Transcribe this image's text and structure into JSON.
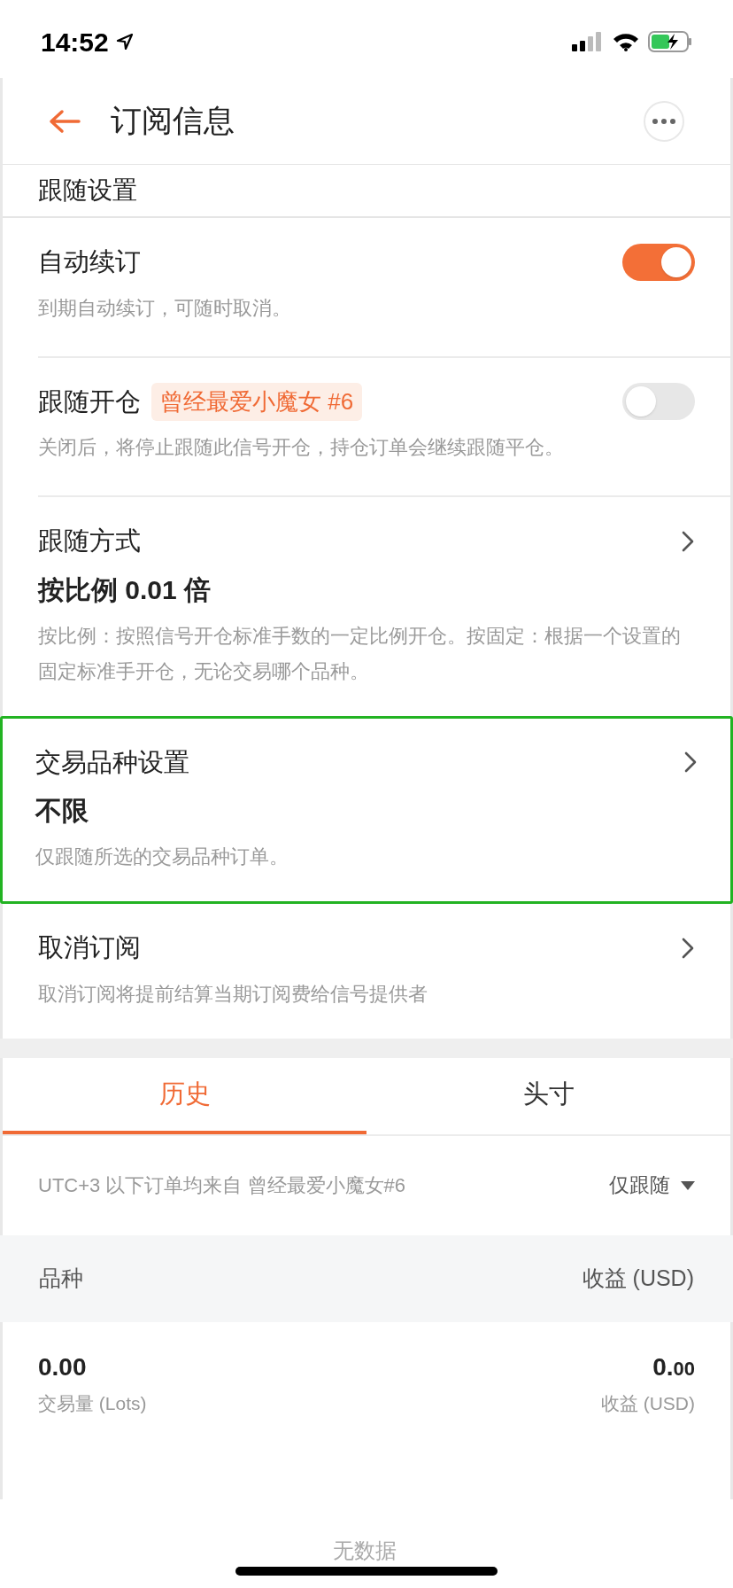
{
  "status_bar": {
    "time": "14:52"
  },
  "header": {
    "title": "订阅信息"
  },
  "section_title": "跟随设置",
  "settings": [
    {
      "kind": "toggle",
      "title": "自动续订",
      "on": true,
      "description": "到期自动续订，可随时取消。"
    },
    {
      "kind": "toggle",
      "title": "跟随开仓",
      "tag": "曾经最爱小魔女 #6",
      "on": false,
      "description": "关闭后，将停止跟随此信号开仓，持仓订单会继续跟随平仓。"
    },
    {
      "kind": "link",
      "title": "跟随方式",
      "value": "按比例 0.01 倍",
      "description": "按比例：按照信号开仓标准手数的一定比例开仓。按固定：根据一个设置的固定标准手开仓，无论交易哪个品种。",
      "highlighted": false
    },
    {
      "kind": "link",
      "title": "交易品种设置",
      "value": "不限",
      "description": "仅跟随所选的交易品种订单。",
      "highlighted": true
    },
    {
      "kind": "link",
      "title": "取消订阅",
      "description": "取消订阅将提前结算当期订阅费给信号提供者",
      "highlighted": false
    }
  ],
  "tabs": [
    {
      "label": "历史",
      "selected": true
    },
    {
      "label": "头寸",
      "selected": false
    }
  ],
  "filter": {
    "info": "UTC+3 以下订单均来自 曾经最爱小魔女#6",
    "dropdown": "仅跟随"
  },
  "table": {
    "columns": [
      "品种",
      "收益 (USD)"
    ]
  },
  "summary": {
    "volume": "0.00",
    "volume_label": "交易量 (Lots)",
    "profit_main": "0.",
    "profit_decimals": "00",
    "profit_label": "收益 (USD)"
  },
  "empty_text": "无数据"
}
